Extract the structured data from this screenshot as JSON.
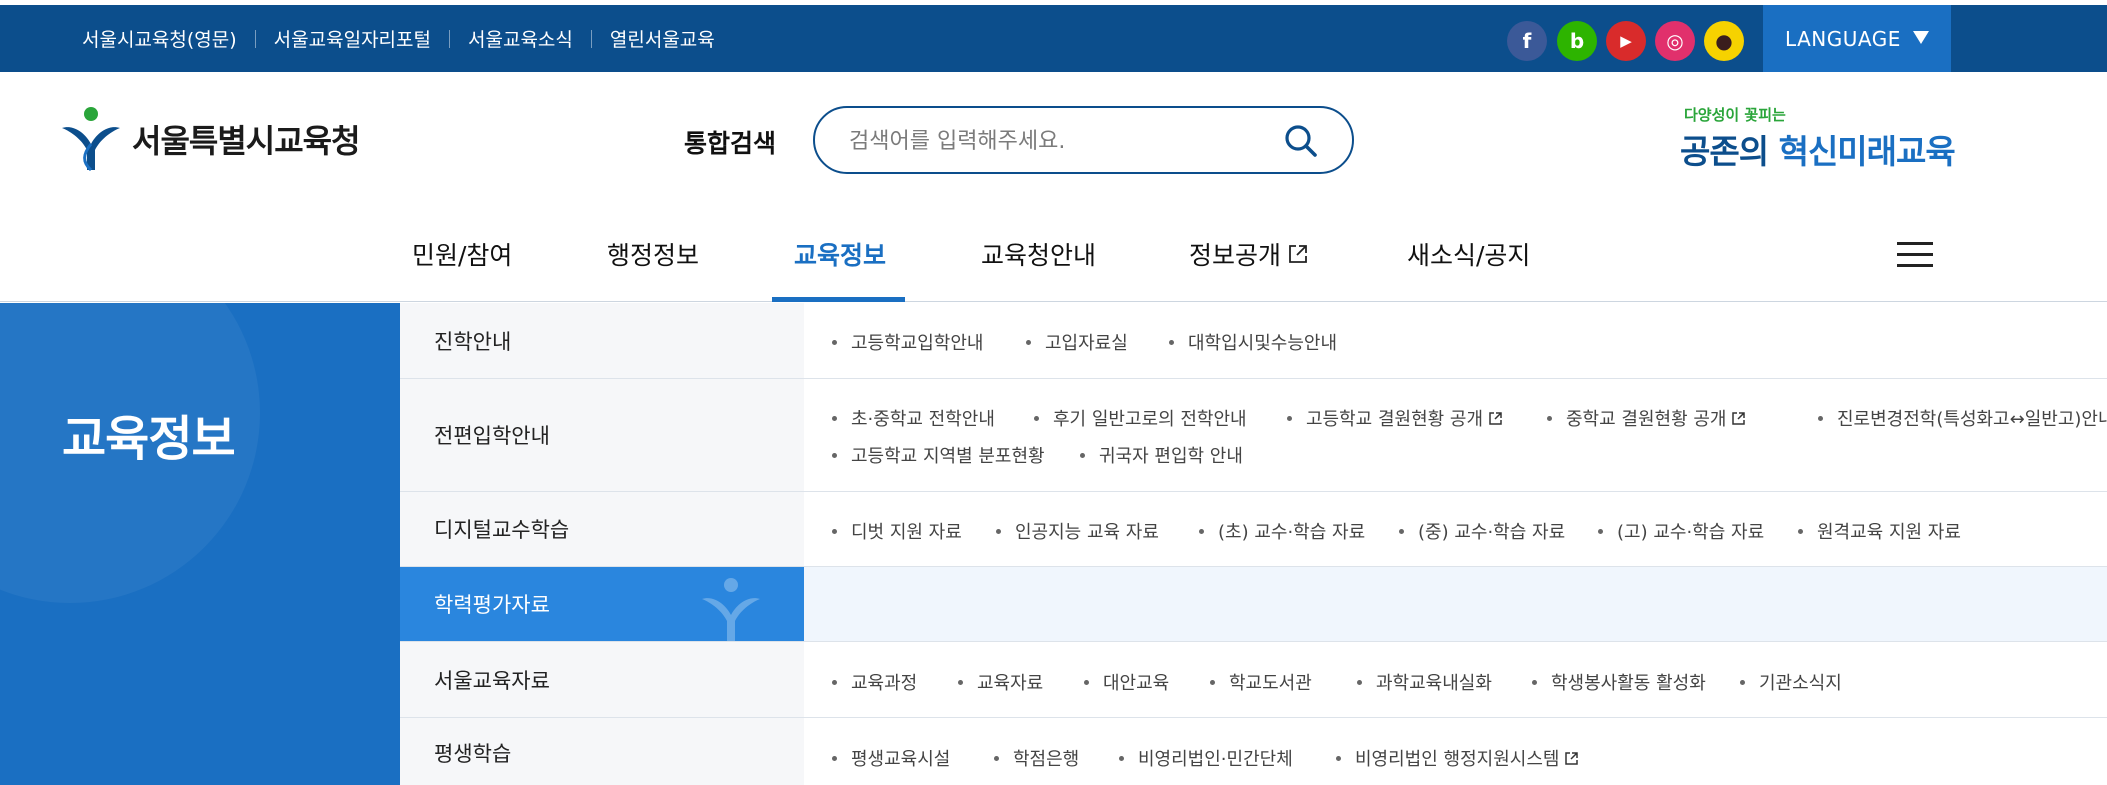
{
  "topbar": {
    "links": [
      "서울시교육청(영문)",
      "서울교육일자리포털",
      "서울교육소식",
      "열린서울교육"
    ],
    "social": [
      {
        "name": "facebook",
        "glyph": "f",
        "color": "#3b5998"
      },
      {
        "name": "blog",
        "glyph": "b",
        "color": "#2db400"
      },
      {
        "name": "youtube",
        "glyph": "▶",
        "color": "#d92b2b"
      },
      {
        "name": "instagram",
        "glyph": "◎",
        "color": "#e1306c"
      },
      {
        "name": "kakao",
        "glyph": "●",
        "color": "#f6d200"
      }
    ],
    "language_label": "LANGUAGE"
  },
  "header": {
    "logo_text": "서울특별시교육청",
    "search_label": "통합검색",
    "search_placeholder": "검색어를 입력해주세요.",
    "slogan_small": "다양성이 꽃피는",
    "slogan_big_part1": "공존의 ",
    "slogan_big_part2": "혁신미래교육"
  },
  "gnb": {
    "items": [
      "민원/참여",
      "행정정보",
      "교육정보",
      "교육청안내",
      "정보공개",
      "새소식/공지"
    ],
    "active": "교육정보"
  },
  "side": {
    "title": "교육정보"
  },
  "rows": [
    {
      "label": "진학안내",
      "items": [
        "고등학교입학안내",
        "고입자료실",
        "대학입시및수능안내"
      ]
    },
    {
      "label": "전편입학안내",
      "items": [
        "초·중학교 전학안내",
        "후기 일반고로의 전학안내",
        "고등학교 결원현황 공개",
        "중학교 결원현황 공개",
        "진로변경전학(특성화고↔일반고)안내",
        "고등학교 지역별 분포현황",
        "귀국자 편입학 안내"
      ]
    },
    {
      "label": "디지털교수학습",
      "items": [
        "디벗 지원 자료",
        "인공지능 교육 자료",
        "(초) 교수·학습 자료",
        "(중) 교수·학습 자료",
        "(고) 교수·학습 자료",
        "원격교육 지원 자료"
      ]
    },
    {
      "label": "학력평가자료",
      "items": []
    },
    {
      "label": "서울교육자료",
      "items": [
        "교육과정",
        "교육자료",
        "대안교육",
        "학교도서관",
        "과학교육내실화",
        "학생봉사활동 활성화",
        "기관소식지"
      ]
    },
    {
      "label": "평생학습",
      "items": [
        "평생교육시설",
        "학점은행",
        "비영리법인·민간단체",
        "비영리법인 행정지원시스템"
      ]
    }
  ],
  "colors": {
    "primary": "#0c4e8c",
    "accent": "#1a6fc2",
    "active_row": "#2a86de"
  }
}
